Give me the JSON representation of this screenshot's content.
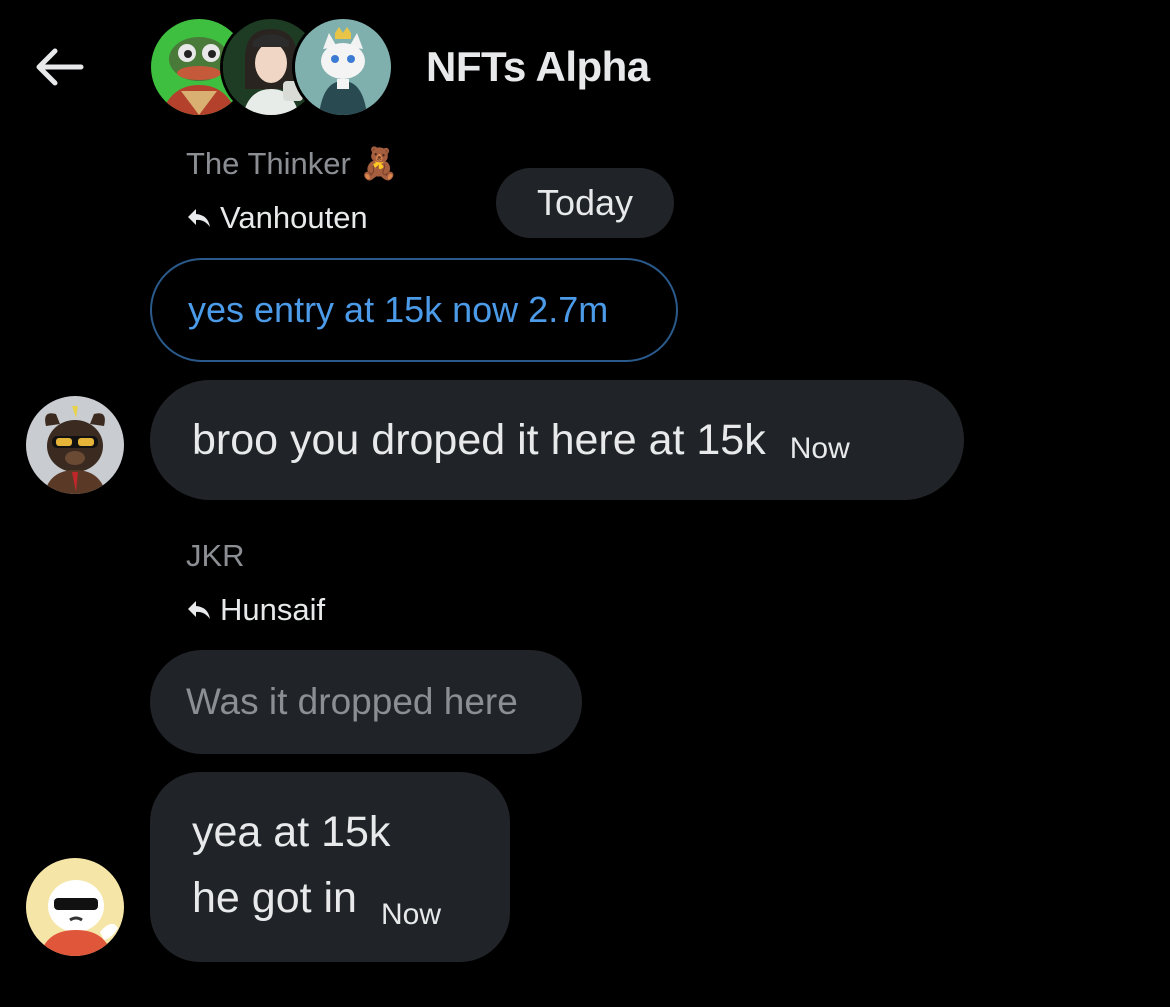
{
  "header": {
    "title": "NFTs Alpha",
    "back_icon": "arrow-left-icon"
  },
  "date_separator": "Today",
  "messages": [
    {
      "sender": "The Thinker",
      "sender_emoji": "🧸",
      "reply_to": "Vanhouten",
      "quoted_text": "yes entry at 15k now 2.7m"
    },
    {
      "text": "broo you droped it here at 15k",
      "time": "Now"
    },
    {
      "sender": "JKR",
      "reply_to": "Hunsaif",
      "quoted_text": "Was it dropped here"
    },
    {
      "lines": [
        "yea at 15k",
        "he got in"
      ],
      "time": "Now"
    }
  ],
  "colors": {
    "background": "#000000",
    "bubble": "#202327",
    "text": "#e7e9ea",
    "muted": "#8b8f94",
    "link_blue": "#4c9be8"
  }
}
